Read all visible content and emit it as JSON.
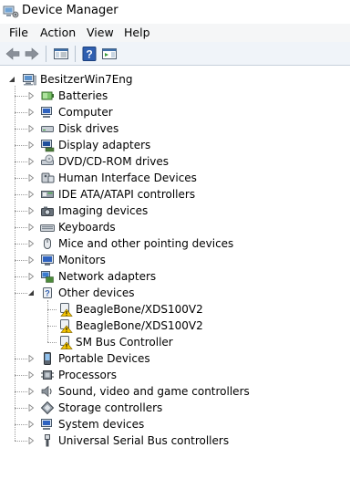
{
  "window": {
    "title": "Device Manager"
  },
  "menu": {
    "file": "File",
    "action": "Action",
    "view": "View",
    "help": "Help"
  },
  "toolbar": {
    "help_glyph": "?"
  },
  "tree": {
    "root": "BesitzerWin7Eng",
    "categories": [
      {
        "label": "Batteries",
        "icon": "battery-icon"
      },
      {
        "label": "Computer",
        "icon": "computer-icon"
      },
      {
        "label": "Disk drives",
        "icon": "disk-drive-icon"
      },
      {
        "label": "Display adapters",
        "icon": "display-adapter-icon"
      },
      {
        "label": "DVD/CD-ROM drives",
        "icon": "dvd-drive-icon"
      },
      {
        "label": "Human Interface Devices",
        "icon": "hid-icon"
      },
      {
        "label": "IDE ATA/ATAPI controllers",
        "icon": "ide-controller-icon"
      },
      {
        "label": "Imaging devices",
        "icon": "camera-icon"
      },
      {
        "label": "Keyboards",
        "icon": "keyboard-icon"
      },
      {
        "label": "Mice and other pointing devices",
        "icon": "mouse-icon"
      },
      {
        "label": "Monitors",
        "icon": "monitor-icon"
      },
      {
        "label": "Network adapters",
        "icon": "network-adapter-icon"
      },
      {
        "label": "Other devices",
        "icon": "unknown-device-icon",
        "expanded": true,
        "children": [
          {
            "label": "BeagleBone/XDS100V2",
            "icon": "warning-device-icon"
          },
          {
            "label": "BeagleBone/XDS100V2",
            "icon": "warning-device-icon"
          },
          {
            "label": "SM Bus Controller",
            "icon": "warning-device-icon"
          }
        ]
      },
      {
        "label": "Portable Devices",
        "icon": "portable-device-icon"
      },
      {
        "label": "Processors",
        "icon": "processor-icon"
      },
      {
        "label": "Sound, video and game controllers",
        "icon": "speaker-icon"
      },
      {
        "label": "Storage controllers",
        "icon": "storage-controller-icon"
      },
      {
        "label": "System devices",
        "icon": "system-device-icon"
      },
      {
        "label": "Universal Serial Bus controllers",
        "icon": "usb-icon"
      }
    ]
  }
}
